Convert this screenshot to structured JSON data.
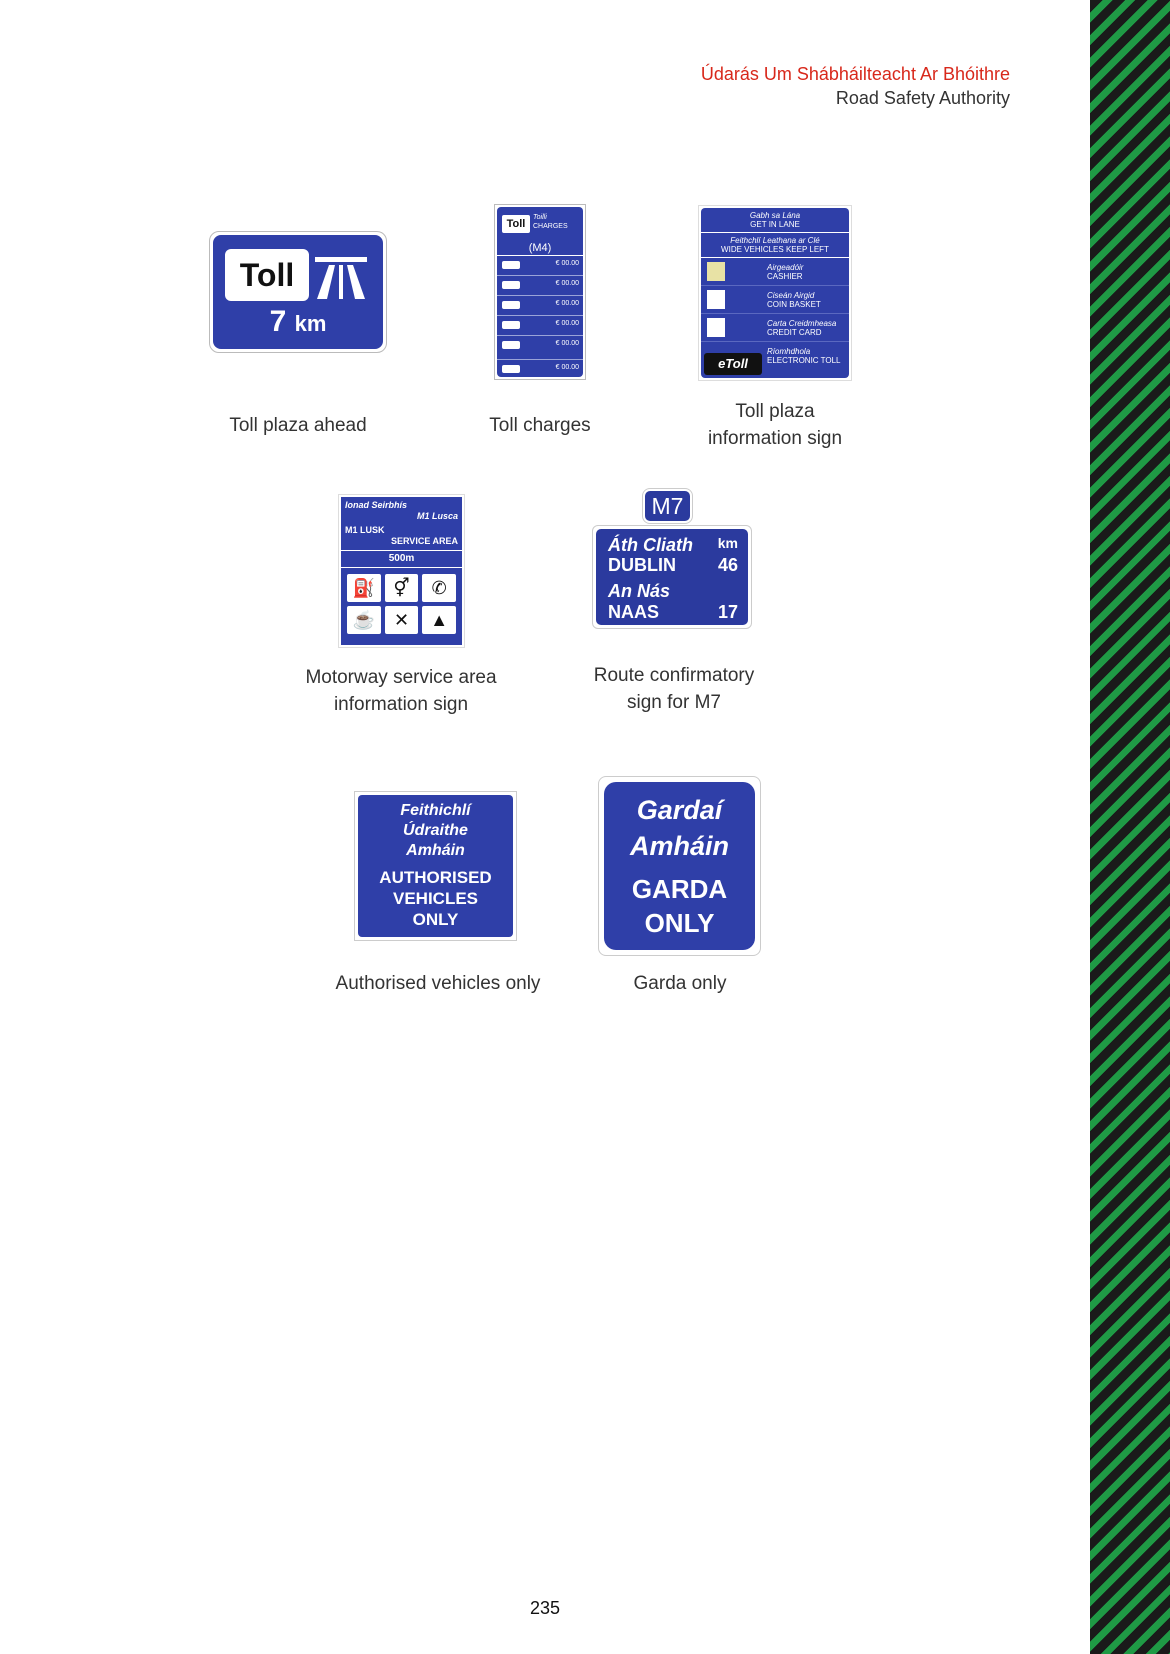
{
  "header": {
    "irish": "Údarás Um Shábháilteacht Ar Bhóithre",
    "english": "Road Safety Authority"
  },
  "signs": {
    "toll_ahead": {
      "word": "Toll",
      "distance": "7",
      "unit": "km",
      "caption": "Toll plaza ahead"
    },
    "toll_charges": {
      "word": "Toll",
      "irish": "Toilli",
      "english": "CHARGES",
      "route": "(M4)",
      "prices": [
        "€ 00.00",
        "€ 00.00",
        "€ 00.00",
        "€ 00.00",
        "€ 00.00",
        "€ 00.00"
      ],
      "caption": "Toll charges"
    },
    "toll_info": {
      "band1_ir": "Gabh sa Lána",
      "band1_en": "GET IN LANE",
      "band2_ir": "Feithchlí Leathana ar Clé",
      "band2_en": "WIDE VEHICLES KEEP LEFT",
      "rows": [
        {
          "ir": "Airgeadóir",
          "en": "CASHIER"
        },
        {
          "ir": "Ciseán Airgid",
          "en": "COIN BASKET"
        },
        {
          "ir": "Carta Creidmheasa",
          "en": "CREDIT CARD"
        },
        {
          "ir": "Ríomhdhola",
          "en": "ELECTRONIC TOLL"
        }
      ],
      "etoll": "eToll",
      "caption": "Toll plaza\ninformation sign"
    },
    "service_area": {
      "ir": "Ionad Seirbhís",
      "ir_place": "M1 Lusca",
      "en_place": "M1 LUSK",
      "en": "SERVICE AREA",
      "distance": "500m",
      "icons": [
        "fuel-icon",
        "toilets-icon",
        "phone-icon",
        "cafe-icon",
        "restaurant-icon",
        "picnic-icon"
      ],
      "caption": "Motorway service area\ninformation sign"
    },
    "m7": {
      "badge": "M7",
      "unit": "km",
      "dest1_ir": "Áth Cliath",
      "dest1_en": "DUBLIN",
      "dest1_km": "46",
      "dest2_ir": "An Nás",
      "dest2_en": "NAAS",
      "dest2_km": "17",
      "caption": "Route confirmatory\nsign for M7"
    },
    "authorised": {
      "ir": "Feithichlí\nÚdraithe\nAmháin",
      "en": "AUTHORISED\nVEHICLES\nONLY",
      "caption": "Authorised vehicles only"
    },
    "garda": {
      "ir": "Gardaí\nAmháin",
      "en": "GARDA\nONLY",
      "caption": "Garda only"
    }
  },
  "page_number": "235",
  "colors": {
    "sign_blue": "#2f3fa8",
    "header_red": "#d8281b",
    "stripe_green": "#1f9a45",
    "stripe_dark": "#1a1a1a"
  }
}
